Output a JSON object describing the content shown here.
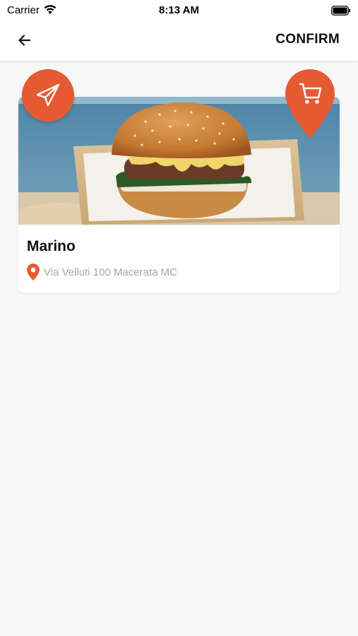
{
  "status_bar": {
    "carrier": "Carrier",
    "time": "8:13 AM"
  },
  "nav": {
    "back_icon": "arrow-left-icon",
    "confirm_label": "CONFIRM"
  },
  "restaurant": {
    "name": "Marino",
    "address": "Via Velluti 100 Macerata MC",
    "image": "burger-photo"
  },
  "actions": {
    "send_icon": "paper-plane-icon",
    "cart_icon": "shopping-cart-icon"
  },
  "colors": {
    "accent": "#e65a33",
    "background": "#f8f8f8",
    "secondary_text": "#a6a6a6"
  }
}
